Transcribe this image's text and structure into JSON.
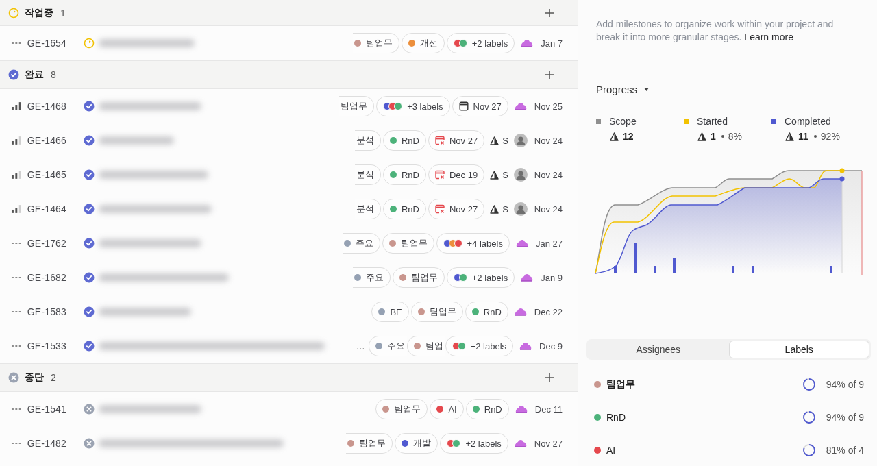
{
  "groups": [
    {
      "status_icon": {
        "kind": "in_progress"
      },
      "name": "작업중",
      "count": "1",
      "issues": [
        {
          "priority_icon": {
            "kind": "none"
          },
          "id": "GE-1654",
          "status_icon": {
            "kind": "in_progress"
          },
          "chips": [
            {
              "kind": "label",
              "text": "팀업무",
              "color": "#c9968e",
              "cut": true
            },
            {
              "kind": "label",
              "text": "개선",
              "color": "#ec8f3c"
            },
            {
              "kind": "labels",
              "text": "+2 labels",
              "dots": [
                {
                  "color": "#e5484d"
                },
                {
                  "color": "#4cb27a"
                }
              ]
            }
          ],
          "assignee": {
            "kind": "blob"
          },
          "date": "Jan 7"
        }
      ]
    },
    {
      "status_icon": {
        "kind": "done"
      },
      "name": "완료",
      "count": "8",
      "issues": [
        {
          "priority_icon": {
            "kind": "high"
          },
          "id": "GE-1468",
          "status_icon": {
            "kind": "done"
          },
          "chips": [
            {
              "kind": "label",
              "text": "팀업무",
              "cut": true
            },
            {
              "kind": "labels",
              "text": "+3 labels",
              "dots": [
                {
                  "color": "#5059d0"
                },
                {
                  "color": "#e5484d"
                },
                {
                  "color": "#4cb27a"
                }
              ]
            },
            {
              "kind": "date",
              "text": "Nov 27",
              "overdue": false
            }
          ],
          "assignee": {
            "kind": "blob"
          },
          "date": "Nov 25"
        },
        {
          "priority_icon": {
            "kind": "medium"
          },
          "id": "GE-1466",
          "status_icon": {
            "kind": "done"
          },
          "chips": [
            {
              "kind": "label",
              "text": "분석",
              "cut": true
            },
            {
              "kind": "label",
              "text": "RnD",
              "color": "#4cb27a"
            },
            {
              "kind": "date",
              "text": "Nov 27",
              "overdue": true
            }
          ],
          "estimate": "S",
          "assignee": {
            "kind": "avatar"
          },
          "date": "Nov 24"
        },
        {
          "priority_icon": {
            "kind": "medium"
          },
          "id": "GE-1465",
          "status_icon": {
            "kind": "done"
          },
          "chips": [
            {
              "kind": "label",
              "text": "분석",
              "cut": true
            },
            {
              "kind": "label",
              "text": "RnD",
              "color": "#4cb27a"
            },
            {
              "kind": "date",
              "text": "Dec 19",
              "overdue": true
            }
          ],
          "estimate": "S",
          "assignee": {
            "kind": "avatar"
          },
          "date": "Nov 24"
        },
        {
          "priority_icon": {
            "kind": "medium"
          },
          "id": "GE-1464",
          "status_icon": {
            "kind": "done"
          },
          "chips": [
            {
              "kind": "label",
              "text": "분석",
              "cut": true
            },
            {
              "kind": "label",
              "text": "RnD",
              "color": "#4cb27a"
            },
            {
              "kind": "date",
              "text": "Nov 27",
              "overdue": true
            }
          ],
          "estimate": "S",
          "assignee": {
            "kind": "avatar"
          },
          "date": "Nov 24"
        },
        {
          "priority_icon": {
            "kind": "none"
          },
          "id": "GE-1762",
          "status_icon": {
            "kind": "done"
          },
          "chips": [
            {
              "kind": "label",
              "text": "주요",
              "color": "#95a1b3",
              "cut": true
            },
            {
              "kind": "label",
              "text": "팀업무",
              "color": "#c9968e"
            },
            {
              "kind": "labels",
              "text": "+4 labels",
              "dots": [
                {
                  "color": "#5059d0"
                },
                {
                  "color": "#ec8f3c"
                },
                {
                  "color": "#e5484d"
                }
              ]
            }
          ],
          "assignee": {
            "kind": "blob"
          },
          "date": "Jan 27"
        },
        {
          "priority_icon": {
            "kind": "none"
          },
          "id": "GE-1682",
          "status_icon": {
            "kind": "done"
          },
          "chips": [
            {
              "kind": "label",
              "text": "주요",
              "color": "#95a1b3",
              "cut": true
            },
            {
              "kind": "label",
              "text": "팀업무",
              "color": "#c9968e"
            },
            {
              "kind": "labels",
              "text": "+2 labels",
              "dots": [
                {
                  "color": "#5059d0"
                },
                {
                  "color": "#4cb27a"
                }
              ]
            }
          ],
          "assignee": {
            "kind": "blob"
          },
          "date": "Jan 9"
        },
        {
          "priority_icon": {
            "kind": "none"
          },
          "id": "GE-1583",
          "status_icon": {
            "kind": "done"
          },
          "chips": [
            {
              "kind": "label",
              "text": "BE",
              "color": "#95a1b3"
            },
            {
              "kind": "label",
              "text": "팀업무",
              "color": "#c9968e"
            },
            {
              "kind": "label",
              "text": "RnD",
              "color": "#4cb27a"
            }
          ],
          "assignee": {
            "kind": "blob"
          },
          "date": "Dec 22"
        },
        {
          "priority_icon": {
            "kind": "none"
          },
          "id": "GE-1533",
          "status_icon": {
            "kind": "done"
          },
          "title_tail": "…",
          "chips": [
            {
              "kind": "label",
              "text": "주요",
              "color": "#95a1b3",
              "overlapped": true
            },
            {
              "kind": "label",
              "text": "팀업",
              "color": "#c9968e",
              "overlapped": true
            },
            {
              "kind": "labels",
              "text": "+2 labels",
              "dots": [
                {
                  "color": "#e5484d"
                },
                {
                  "color": "#4cb27a"
                }
              ]
            }
          ],
          "assignee": {
            "kind": "blob"
          },
          "date": "Dec 9"
        }
      ]
    },
    {
      "status_icon": {
        "kind": "canceled"
      },
      "name": "중단",
      "count": "2",
      "issues": [
        {
          "priority_icon": {
            "kind": "none"
          },
          "id": "GE-1541",
          "status_icon": {
            "kind": "canceled"
          },
          "chips": [
            {
              "kind": "label",
              "text": "팀업무",
              "color": "#c9968e"
            },
            {
              "kind": "label",
              "text": "AI",
              "color": "#e5484d"
            },
            {
              "kind": "label",
              "text": "RnD",
              "color": "#4cb27a"
            }
          ],
          "assignee": {
            "kind": "blob"
          },
          "date": "Dec 11"
        },
        {
          "priority_icon": {
            "kind": "none"
          },
          "id": "GE-1482",
          "status_icon": {
            "kind": "canceled"
          },
          "chips": [
            {
              "kind": "label",
              "text": "팀업무",
              "color": "#c9968e",
              "cut": true
            },
            {
              "kind": "label",
              "text": "개발",
              "color": "#5059d0"
            },
            {
              "kind": "labels",
              "text": "+2 labels",
              "dots": [
                {
                  "color": "#e5484d"
                },
                {
                  "color": "#4cb27a"
                }
              ]
            }
          ],
          "assignee": {
            "kind": "blob"
          },
          "date": "Nov 27"
        }
      ]
    }
  ],
  "side": {
    "description": "Add milestones to organize work within your project and break it into more granular stages.",
    "learn_more": "Learn more",
    "progress_label": "Progress",
    "stats": [
      {
        "name": "Scope",
        "color": "#8f8f8f",
        "count": "12"
      },
      {
        "name": "Started",
        "color": "#f2c200",
        "count": "1",
        "percent": "8%"
      },
      {
        "name": "Completed",
        "color": "#5059d0",
        "count": "11",
        "percent": "92%"
      }
    ],
    "tabs": [
      {
        "label": "Assignees",
        "selected": false
      },
      {
        "label": "Labels",
        "selected": true
      }
    ],
    "labels": [
      {
        "name": "팀업무",
        "color": "#c9968e",
        "reading": "94% of 9"
      },
      {
        "name": "RnD",
        "color": "#4cb27a",
        "reading": "94% of 9"
      },
      {
        "name": "AI",
        "color": "#e5484d",
        "reading": "81% of 4"
      }
    ]
  }
}
